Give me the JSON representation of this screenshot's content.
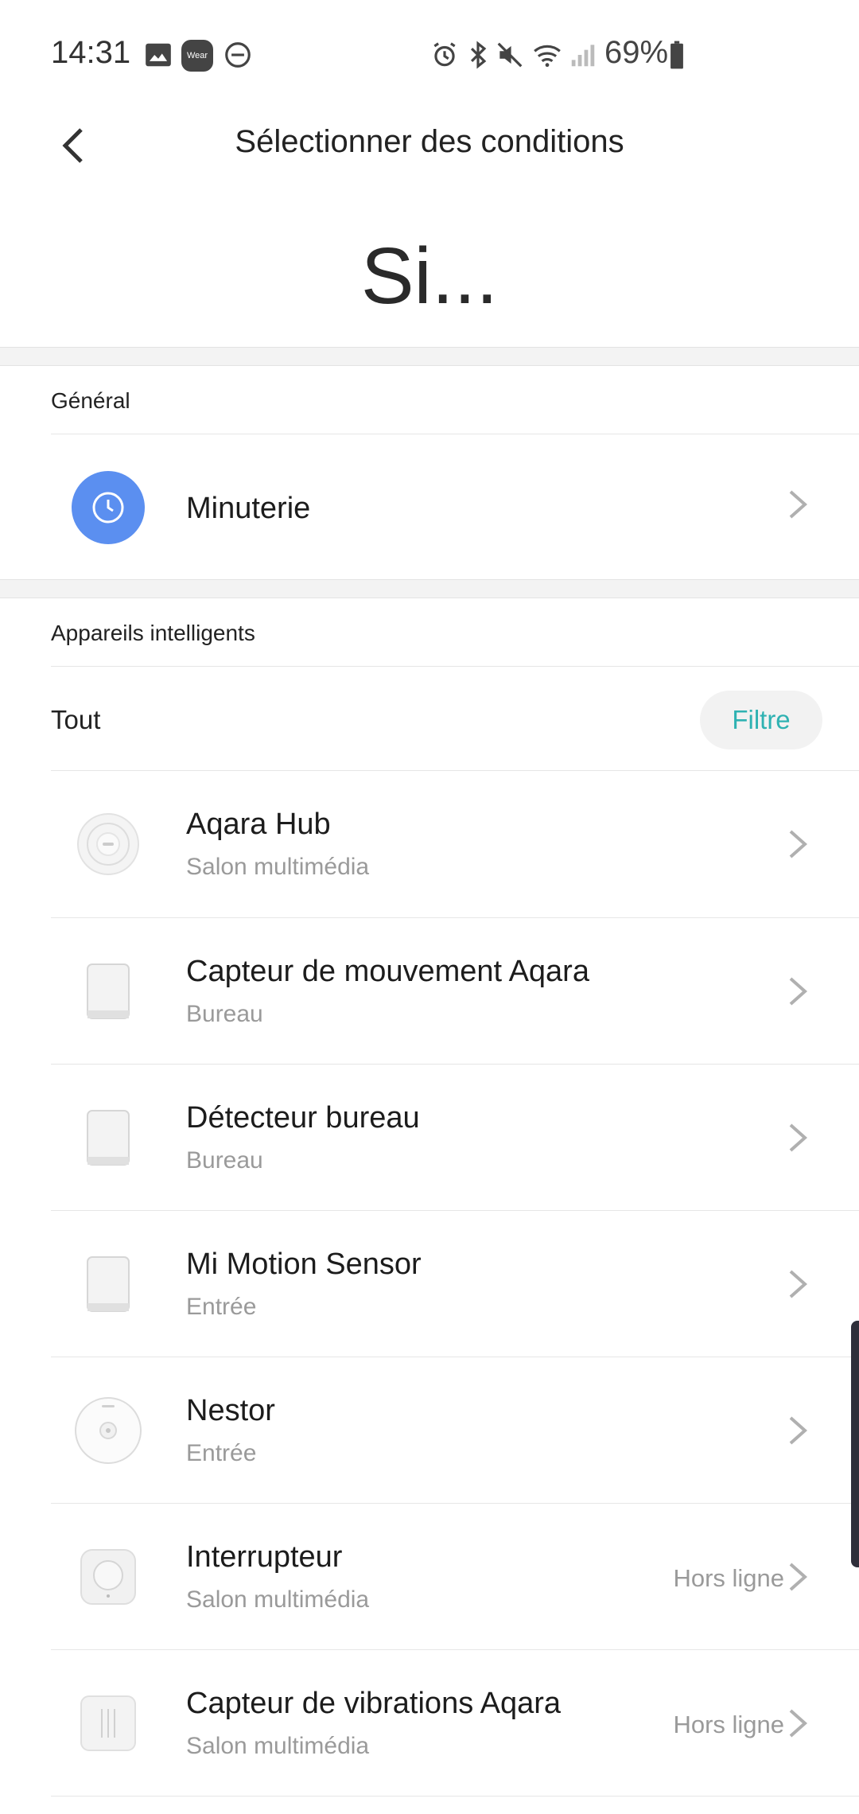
{
  "status_bar": {
    "time": "14:31",
    "battery": "69%",
    "icons": [
      "image-icon",
      "wear-icon",
      "dnd-icon",
      "alarm-icon",
      "bluetooth-icon",
      "mute-icon",
      "wifi-icon",
      "signal-icon",
      "battery-icon"
    ],
    "wear_label": "Wear"
  },
  "header": {
    "title": "Sélectionner des conditions",
    "heading": "Si..."
  },
  "general": {
    "section_title": "Général",
    "timer_label": "Minuterie"
  },
  "devices": {
    "section_title": "Appareils intelligents",
    "filter_all": "Tout",
    "filter_button": "Filtre",
    "items": [
      {
        "name": "Aqara Hub",
        "room": "Salon multimédia",
        "status": ""
      },
      {
        "name": "Capteur de mouvement Aqara",
        "room": "Bureau",
        "status": ""
      },
      {
        "name": "Détecteur bureau",
        "room": "Bureau",
        "status": ""
      },
      {
        "name": "Mi Motion Sensor",
        "room": "Entrée",
        "status": ""
      },
      {
        "name": "Nestor",
        "room": "Entrée",
        "status": ""
      },
      {
        "name": "Interrupteur",
        "room": "Salon multimédia",
        "status": "Hors ligne"
      },
      {
        "name": "Capteur de vibrations Aqara",
        "room": "Salon multimédia",
        "status": "Hors ligne"
      }
    ]
  },
  "colors": {
    "accent_teal": "#2fb2b2",
    "timer_blue": "#5b8ff0"
  }
}
